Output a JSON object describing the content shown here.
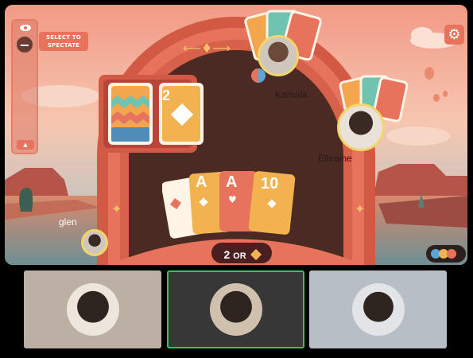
{
  "spectate": {
    "label": "SELECT TO SPECTATE",
    "minus": "−",
    "collapse": "▲"
  },
  "settings": {
    "icon": "gear-icon",
    "glyph": "⚙"
  },
  "players": {
    "kamala": {
      "name": "Kamala"
    },
    "elleaine": {
      "name": "Elleaine"
    },
    "glen": {
      "name": "glen"
    }
  },
  "table": {
    "discard_top": {
      "rank": "2",
      "suit": "diamond"
    },
    "hand": [
      {
        "rank": "",
        "suit": "diamond"
      },
      {
        "rank": "A",
        "suit": "diamond"
      },
      {
        "rank": "A",
        "suit": "heart"
      },
      {
        "rank": "10",
        "suit": "diamond"
      }
    ]
  },
  "draw_button": {
    "count": "2",
    "or": "OR",
    "suit": "diamond"
  },
  "color_dots": [
    "#5aa6d6",
    "#f2b24f",
    "#e8735c"
  ],
  "video_tiles": [
    {
      "name": "participant-1",
      "bg": "#bcb0a5",
      "active": false
    },
    {
      "name": "participant-2",
      "bg": "#373737",
      "active": true
    },
    {
      "name": "participant-3",
      "bg": "#b8bec6",
      "active": false
    }
  ],
  "colors": {
    "accent": "#e8735c",
    "active_border": "#34c759"
  }
}
